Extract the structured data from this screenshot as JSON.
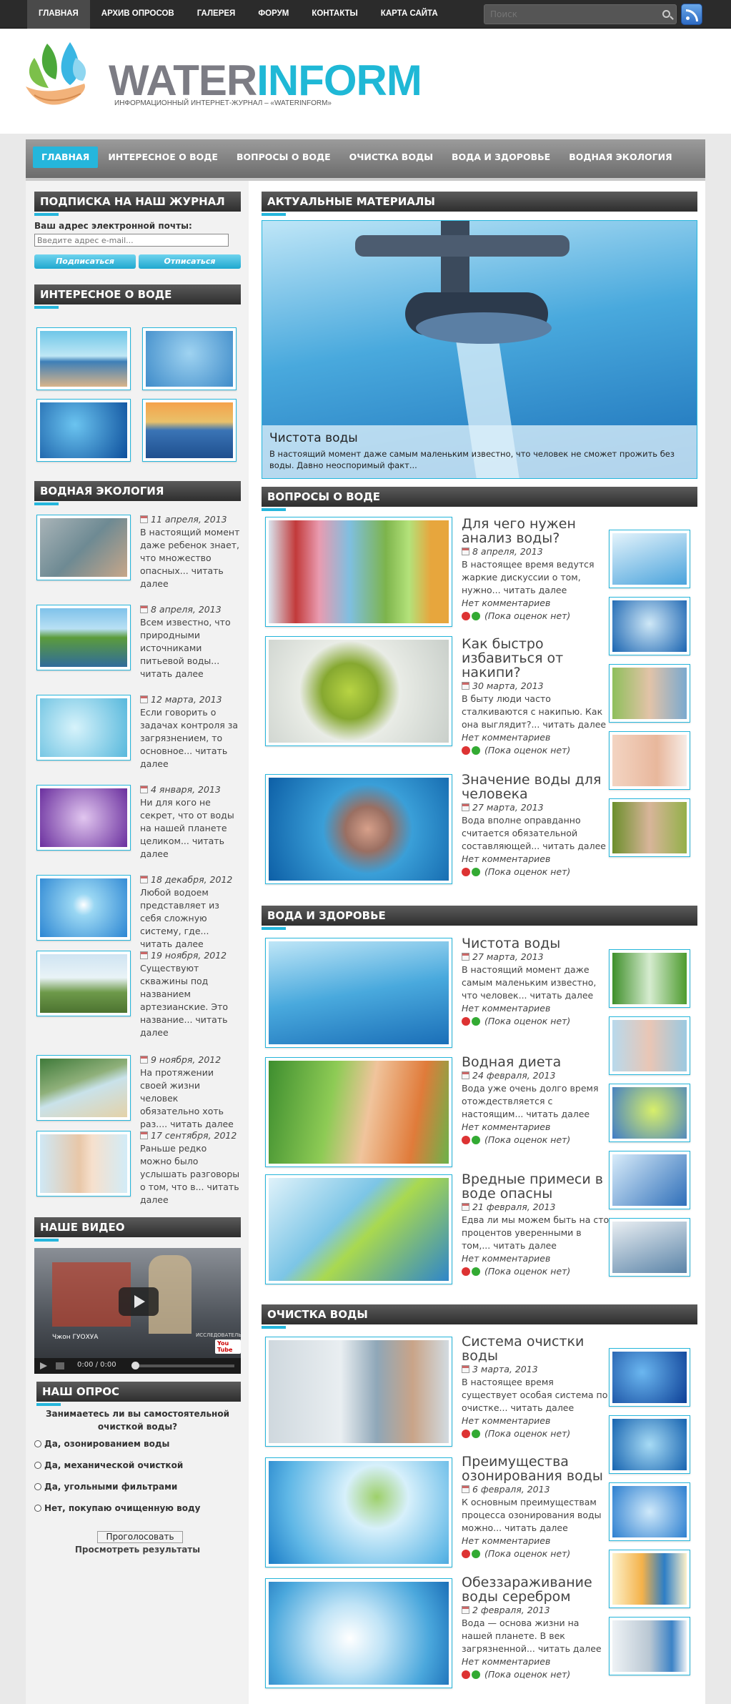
{
  "topnav": {
    "items": [
      "ГЛАВНАЯ",
      "АРХИВ ОПРОСОВ",
      "ГАЛЕРЕЯ",
      "ФОРУМ",
      "КОНТАКТЫ",
      "КАРТА САЙТА"
    ],
    "search_placeholder": "Поиск"
  },
  "header": {
    "logo_part1": "WATER",
    "logo_part2": "INFORM",
    "tagline": "ИНФОРМАЦИОННЫЙ ИНТЕРНЕТ-ЖУРНАЛ – «WATERINFORM»"
  },
  "mainnav": {
    "items": [
      "ГЛАВНАЯ",
      "ИНТЕРЕСНОЕ О ВОДЕ",
      "ВОПРОСЫ О ВОДЕ",
      "ОЧИСТКА ВОДЫ",
      "ВОДА И ЗДОРОВЬЕ",
      "ВОДНАЯ ЭКОЛОГИЯ"
    ]
  },
  "sidebar": {
    "subscribe": {
      "title": "ПОДПИСКА НА НАШ ЖУРНАЛ",
      "label": "Ваш адрес электронной почты:",
      "placeholder": "Введите адрес e-mail...",
      "subscribe_btn": "Подписаться",
      "unsubscribe_btn": "Отписаться"
    },
    "interesting_title": "ИНТЕРЕСНОЕ О ВОДЕ",
    "ecology": {
      "title": "ВОДНАЯ ЭКОЛОГИЯ",
      "items": [
        {
          "date": "11 апреля, 2013",
          "text": "В настоящий момент даже ребенок знает, что множество опасных... читать далее"
        },
        {
          "date": "8 апреля, 2013",
          "text": "Всем известно, что природными источниками питьевой воды... читать далее"
        },
        {
          "date": "12 марта, 2013",
          "text": "Если говорить о задачах контроля за загрязнением, то основное... читать далее"
        },
        {
          "date": "4 января, 2013",
          "text": "Ни для кого не секрет, что от воды на нашей планете целиком... читать далее"
        },
        {
          "date": "18 декабря, 2012",
          "text": "Любой водоем представляет из себя сложную систему, где... читать далее"
        },
        {
          "date": "19 ноября, 2012",
          "text": "Существуют скважины под названием артезианские. Это название... читать далее"
        },
        {
          "date": "9 ноября, 2012",
          "text": "На протяжении своей жизни человек обязательно хоть раз.... читать далее"
        },
        {
          "date": "17 сентября, 2012",
          "text": "Раньше редко можно было услышать разговоры о том, что в... читать далее"
        }
      ]
    },
    "video": {
      "title": "НАШЕ ВИДЕО",
      "caption": "Чжон ГУОХУА",
      "caption2": "ИССЛЕДОВАТЕЛЬ",
      "time": "0:00 / 0:00",
      "brand": "You Tube"
    },
    "poll": {
      "title": "НАШ ОПРОС",
      "question": "Занимаетесь ли вы самостоятельной очисткой воды?",
      "options": [
        "Да, озонированием воды",
        "Да, механической очисткой",
        "Да, угольными фильтрами",
        "Нет, покупаю очищенную воду"
      ],
      "vote_btn": "Проголосовать",
      "results": "Просмотреть результаты"
    }
  },
  "main": {
    "featured": {
      "title": "АКТУАЛЬНЫЕ МАТЕРИАЛЫ",
      "caption_title": "Чистота воды",
      "caption_text": "В настоящий момент даже самым маленьким известно, что человек не сможет прожить без воды. Давно неоспоримый факт..."
    },
    "sections": [
      {
        "title": "ВОПРОСЫ О ВОДЕ",
        "articles": [
          {
            "title": "Для чего нужен анализ воды?",
            "date": "8 апреля, 2013",
            "text": "В настоящее время ведутся жаркие дискуссии о том, нужно... читать далее",
            "comments": "Нет комментариев",
            "votes": "(Пока оценок нет)"
          },
          {
            "title": "Как быстро избавиться от накипи?",
            "date": "30 марта, 2013",
            "text": "В быту люди часто сталкиваются с накипью. Как она выглядит?... читать далее",
            "comments": "Нет комментариев",
            "votes": "(Пока оценок нет)"
          },
          {
            "title": "Значение воды для человека",
            "date": "27 марта, 2013",
            "text": "Вода вполне оправданно считается обязательной составляющей... читать далее",
            "comments": "Нет комментариев",
            "votes": "(Пока оценок нет)"
          }
        ]
      },
      {
        "title": "ВОДА И ЗДОРОВЬЕ",
        "articles": [
          {
            "title": "Чистота воды",
            "date": "27 марта, 2013",
            "text": "В настоящий момент даже самым маленьким известно, что человек... читать далее",
            "comments": "Нет комментариев",
            "votes": "(Пока оценок нет)"
          },
          {
            "title": "Водная диета",
            "date": "24 февраля, 2013",
            "text": "Вода уже очень долго время отождествляется с настоящим... читать далее",
            "comments": "Нет комментариев",
            "votes": "(Пока оценок нет)"
          },
          {
            "title": "Вредные примеси в воде опасны",
            "date": "21 февраля, 2013",
            "text": "Едва ли мы можем быть на сто процентов уверенными в том,... читать далее",
            "comments": "Нет комментариев",
            "votes": "(Пока оценок нет)"
          }
        ]
      },
      {
        "title": "ОЧИСТКА ВОДЫ",
        "articles": [
          {
            "title": "Система очистки воды",
            "date": "3 марта, 2013",
            "text": "В настоящее время существует особая система по очистке... читать далее",
            "comments": "Нет комментариев",
            "votes": "(Пока оценок нет)"
          },
          {
            "title": "Преимущества озонирования воды",
            "date": "6 февраля, 2013",
            "text": "К основным преимуществам процесса озонирования воды можно... читать далее",
            "comments": "Нет комментариев",
            "votes": "(Пока оценок нет)"
          },
          {
            "title": "Обеззараживание воды серебром",
            "date": "2 февраля, 2013",
            "text": "Вода — основа жизни на нашей планете. В век загрязненной... читать далее",
            "comments": "Нет комментариев",
            "votes": "(Пока оценок нет)"
          }
        ]
      }
    ]
  },
  "colors": {
    "accent": "#25b6dc",
    "topbar": "#2b2b2b",
    "nav": "#7c7c7c"
  }
}
